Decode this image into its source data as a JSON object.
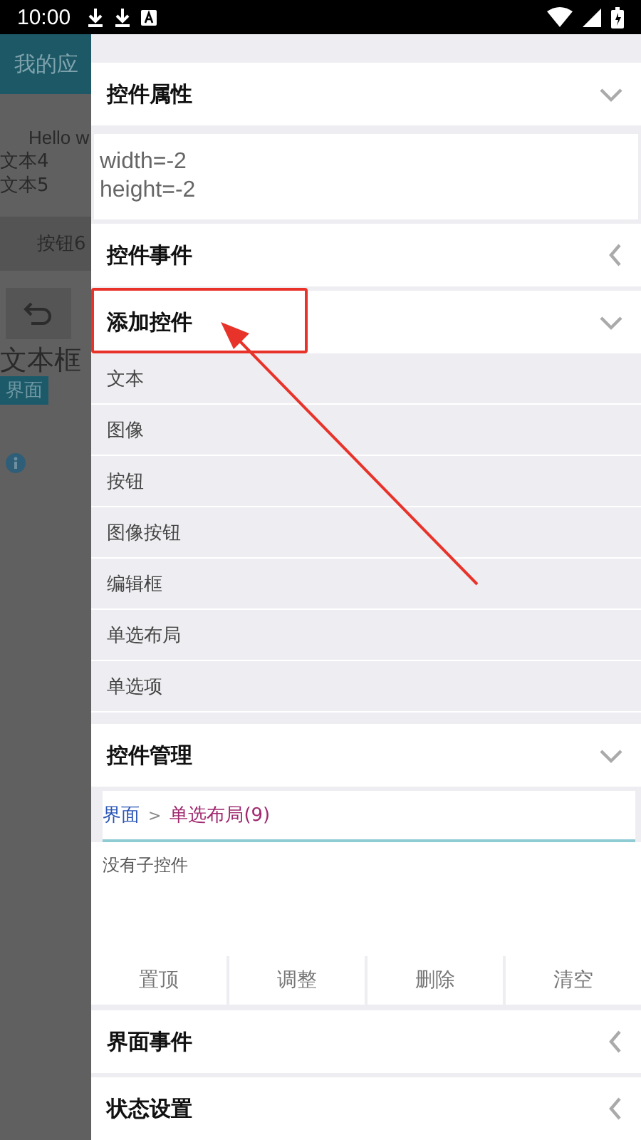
{
  "status_bar": {
    "time": "10:00"
  },
  "background_app": {
    "title": "我的应",
    "texts": [
      "Hello w",
      "文本4",
      "文本5"
    ],
    "button": "按钮6",
    "text_box": "文本框",
    "tag": "界面"
  },
  "drawer": {
    "sections": [
      {
        "kind": "properties",
        "title": "控件属性",
        "expanded": true,
        "annotated": false,
        "lines": [
          "width=-2",
          "height=-2"
        ]
      },
      {
        "kind": "plain",
        "title": "控件事件",
        "expanded": false,
        "annotated": false
      },
      {
        "kind": "list",
        "title": "添加控件",
        "expanded": true,
        "annotated": true,
        "items": [
          "文本",
          "图像",
          "按钮",
          "图像按钮",
          "编辑框",
          "单选布局",
          "单选项"
        ]
      },
      {
        "kind": "manager",
        "title": "控件管理",
        "expanded": true,
        "annotated": false,
        "breadcrumb": {
          "root": "界面",
          "separator": ">",
          "current": "单选布局(9)"
        },
        "empty_text": "没有子控件",
        "buttons": [
          "置顶",
          "调整",
          "删除",
          "清空"
        ]
      },
      {
        "kind": "plain",
        "title": "界面事件",
        "expanded": false,
        "annotated": false
      },
      {
        "kind": "plain",
        "title": "状态设置",
        "expanded": false,
        "annotated": false
      }
    ]
  }
}
